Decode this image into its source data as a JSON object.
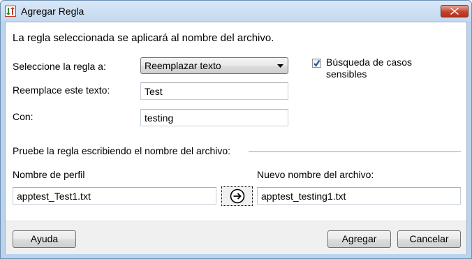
{
  "window": {
    "title": "Agregar Regla",
    "close_icon": "close-icon",
    "app_icon": "rename-rule-icon"
  },
  "form": {
    "intro": "La regla seleccionada se aplicará al nombre del archivo.",
    "rule_label": "Seleccione la regla a:",
    "rule_selected": "Reemplazar texto",
    "replace_label": "Reemplace este texto:",
    "replace_value": "Test",
    "with_label": "Con:",
    "with_value": "testing",
    "case_sensitive_label": "Búsqueda de casos sensibles",
    "case_sensitive_checked": true
  },
  "test": {
    "group_label": "Pruebe la regla escribiendo el nombre del archivo:",
    "profile_label": "Nombre de perfil",
    "profile_value": "apptest_Test1.txt",
    "new_name_label": "Nuevo nombre del archivo:",
    "new_name_value": "apptest_testing1.txt",
    "go_icon": "arrow-right-circle-icon"
  },
  "buttons": {
    "help": "Ayuda",
    "add": "Agregar",
    "cancel": "Cancelar"
  },
  "colors": {
    "titlebar": "#c3d8ef",
    "close_button": "#c7432d",
    "checkmark": "#2b4fa3"
  }
}
